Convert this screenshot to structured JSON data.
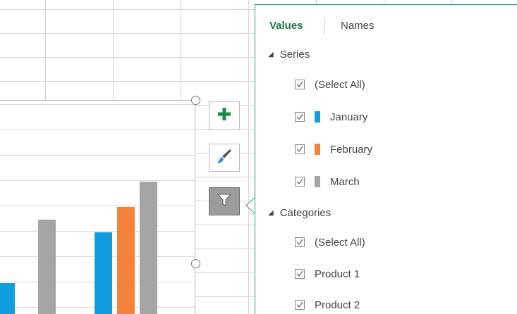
{
  "colors": {
    "accent": "#217346",
    "series_january": "#119ee0",
    "series_february": "#f4823a",
    "series_march": "#a5a5a5"
  },
  "filter_panel": {
    "tabs": [
      {
        "label": "Values",
        "selected": true
      },
      {
        "label": "Names",
        "selected": false
      }
    ],
    "series_group": {
      "label": "Series",
      "items": [
        {
          "label": "(Select All)",
          "checked": true
        },
        {
          "label": "January",
          "checked": true,
          "color": "#119ee0"
        },
        {
          "label": "February",
          "checked": true,
          "color": "#f4823a"
        },
        {
          "label": "March",
          "checked": true,
          "color": "#a5a5a5"
        }
      ]
    },
    "categories_group": {
      "label": "Categories",
      "items": [
        {
          "label": "(Select All)",
          "checked": true
        },
        {
          "label": "Product 1",
          "checked": true
        },
        {
          "label": "Product 2",
          "checked": true
        }
      ]
    }
  },
  "chart_buttons": [
    {
      "name": "chart-elements",
      "icon": "plus-icon"
    },
    {
      "name": "chart-styles",
      "icon": "paintbrush-icon"
    },
    {
      "name": "chart-filters",
      "icon": "funnel-icon",
      "active": true
    }
  ]
}
